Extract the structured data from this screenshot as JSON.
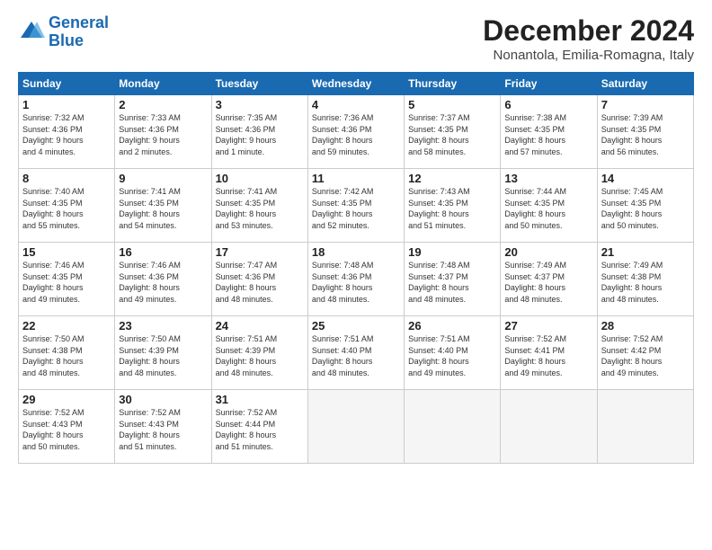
{
  "header": {
    "logo_line1": "General",
    "logo_line2": "Blue",
    "month": "December 2024",
    "location": "Nonantola, Emilia-Romagna, Italy"
  },
  "weekdays": [
    "Sunday",
    "Monday",
    "Tuesday",
    "Wednesday",
    "Thursday",
    "Friday",
    "Saturday"
  ],
  "weeks": [
    [
      {
        "num": "1",
        "info": "Sunrise: 7:32 AM\nSunset: 4:36 PM\nDaylight: 9 hours\nand 4 minutes."
      },
      {
        "num": "2",
        "info": "Sunrise: 7:33 AM\nSunset: 4:36 PM\nDaylight: 9 hours\nand 2 minutes."
      },
      {
        "num": "3",
        "info": "Sunrise: 7:35 AM\nSunset: 4:36 PM\nDaylight: 9 hours\nand 1 minute."
      },
      {
        "num": "4",
        "info": "Sunrise: 7:36 AM\nSunset: 4:36 PM\nDaylight: 8 hours\nand 59 minutes."
      },
      {
        "num": "5",
        "info": "Sunrise: 7:37 AM\nSunset: 4:35 PM\nDaylight: 8 hours\nand 58 minutes."
      },
      {
        "num": "6",
        "info": "Sunrise: 7:38 AM\nSunset: 4:35 PM\nDaylight: 8 hours\nand 57 minutes."
      },
      {
        "num": "7",
        "info": "Sunrise: 7:39 AM\nSunset: 4:35 PM\nDaylight: 8 hours\nand 56 minutes."
      }
    ],
    [
      {
        "num": "8",
        "info": "Sunrise: 7:40 AM\nSunset: 4:35 PM\nDaylight: 8 hours\nand 55 minutes."
      },
      {
        "num": "9",
        "info": "Sunrise: 7:41 AM\nSunset: 4:35 PM\nDaylight: 8 hours\nand 54 minutes."
      },
      {
        "num": "10",
        "info": "Sunrise: 7:41 AM\nSunset: 4:35 PM\nDaylight: 8 hours\nand 53 minutes."
      },
      {
        "num": "11",
        "info": "Sunrise: 7:42 AM\nSunset: 4:35 PM\nDaylight: 8 hours\nand 52 minutes."
      },
      {
        "num": "12",
        "info": "Sunrise: 7:43 AM\nSunset: 4:35 PM\nDaylight: 8 hours\nand 51 minutes."
      },
      {
        "num": "13",
        "info": "Sunrise: 7:44 AM\nSunset: 4:35 PM\nDaylight: 8 hours\nand 50 minutes."
      },
      {
        "num": "14",
        "info": "Sunrise: 7:45 AM\nSunset: 4:35 PM\nDaylight: 8 hours\nand 50 minutes."
      }
    ],
    [
      {
        "num": "15",
        "info": "Sunrise: 7:46 AM\nSunset: 4:35 PM\nDaylight: 8 hours\nand 49 minutes."
      },
      {
        "num": "16",
        "info": "Sunrise: 7:46 AM\nSunset: 4:36 PM\nDaylight: 8 hours\nand 49 minutes."
      },
      {
        "num": "17",
        "info": "Sunrise: 7:47 AM\nSunset: 4:36 PM\nDaylight: 8 hours\nand 48 minutes."
      },
      {
        "num": "18",
        "info": "Sunrise: 7:48 AM\nSunset: 4:36 PM\nDaylight: 8 hours\nand 48 minutes."
      },
      {
        "num": "19",
        "info": "Sunrise: 7:48 AM\nSunset: 4:37 PM\nDaylight: 8 hours\nand 48 minutes."
      },
      {
        "num": "20",
        "info": "Sunrise: 7:49 AM\nSunset: 4:37 PM\nDaylight: 8 hours\nand 48 minutes."
      },
      {
        "num": "21",
        "info": "Sunrise: 7:49 AM\nSunset: 4:38 PM\nDaylight: 8 hours\nand 48 minutes."
      }
    ],
    [
      {
        "num": "22",
        "info": "Sunrise: 7:50 AM\nSunset: 4:38 PM\nDaylight: 8 hours\nand 48 minutes."
      },
      {
        "num": "23",
        "info": "Sunrise: 7:50 AM\nSunset: 4:39 PM\nDaylight: 8 hours\nand 48 minutes."
      },
      {
        "num": "24",
        "info": "Sunrise: 7:51 AM\nSunset: 4:39 PM\nDaylight: 8 hours\nand 48 minutes."
      },
      {
        "num": "25",
        "info": "Sunrise: 7:51 AM\nSunset: 4:40 PM\nDaylight: 8 hours\nand 48 minutes."
      },
      {
        "num": "26",
        "info": "Sunrise: 7:51 AM\nSunset: 4:40 PM\nDaylight: 8 hours\nand 49 minutes."
      },
      {
        "num": "27",
        "info": "Sunrise: 7:52 AM\nSunset: 4:41 PM\nDaylight: 8 hours\nand 49 minutes."
      },
      {
        "num": "28",
        "info": "Sunrise: 7:52 AM\nSunset: 4:42 PM\nDaylight: 8 hours\nand 49 minutes."
      }
    ],
    [
      {
        "num": "29",
        "info": "Sunrise: 7:52 AM\nSunset: 4:43 PM\nDaylight: 8 hours\nand 50 minutes."
      },
      {
        "num": "30",
        "info": "Sunrise: 7:52 AM\nSunset: 4:43 PM\nDaylight: 8 hours\nand 51 minutes."
      },
      {
        "num": "31",
        "info": "Sunrise: 7:52 AM\nSunset: 4:44 PM\nDaylight: 8 hours\nand 51 minutes."
      },
      null,
      null,
      null,
      null
    ]
  ]
}
